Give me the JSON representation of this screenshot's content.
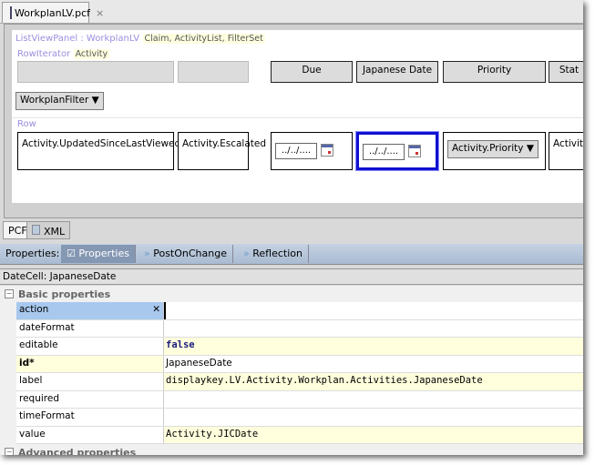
{
  "file_tab": {
    "title": "WorkplanLV.pcf",
    "close": "×"
  },
  "canvas": {
    "panel_label": "ListViewPanel : WorkplanLV",
    "panel_args": "Claim, ActivityList, FilterSet",
    "iterator_label": "RowIterator",
    "iterator_arg": "Activity",
    "headers": [
      "",
      "",
      "Due",
      "Japanese Date",
      "Priority",
      "Stat"
    ],
    "filter_button": "WorkplanFilter",
    "row_label": "Row",
    "cells": {
      "updated": "Activity.UpdatedSinceLastViewed",
      "escalated": "Activity.Escalated",
      "due": "../../....",
      "japanese": "../../....",
      "priority": "Activity.Priority",
      "last": "Activity"
    }
  },
  "bottom_tabs": [
    "PCF",
    "XML"
  ],
  "properties_bar": {
    "label": "Properties:",
    "tabs": [
      "Properties",
      "PostOnChange",
      "Reflection"
    ]
  },
  "selection": "DateCell: JapaneseDate",
  "sections": {
    "basic": "Basic properties",
    "advanced": "Advanced properties"
  },
  "properties": [
    {
      "key": "action",
      "value": ""
    },
    {
      "key": "dateFormat",
      "value": ""
    },
    {
      "key": "editable",
      "value": "false"
    },
    {
      "key": "id*",
      "value": "JapaneseDate"
    },
    {
      "key": "label",
      "value": "displaykey.LV.Activity.Workplan.Activities.JapaneseDate"
    },
    {
      "key": "required",
      "value": ""
    },
    {
      "key": "timeFormat",
      "value": ""
    },
    {
      "key": "value",
      "value": "Activity.JICDate"
    }
  ]
}
